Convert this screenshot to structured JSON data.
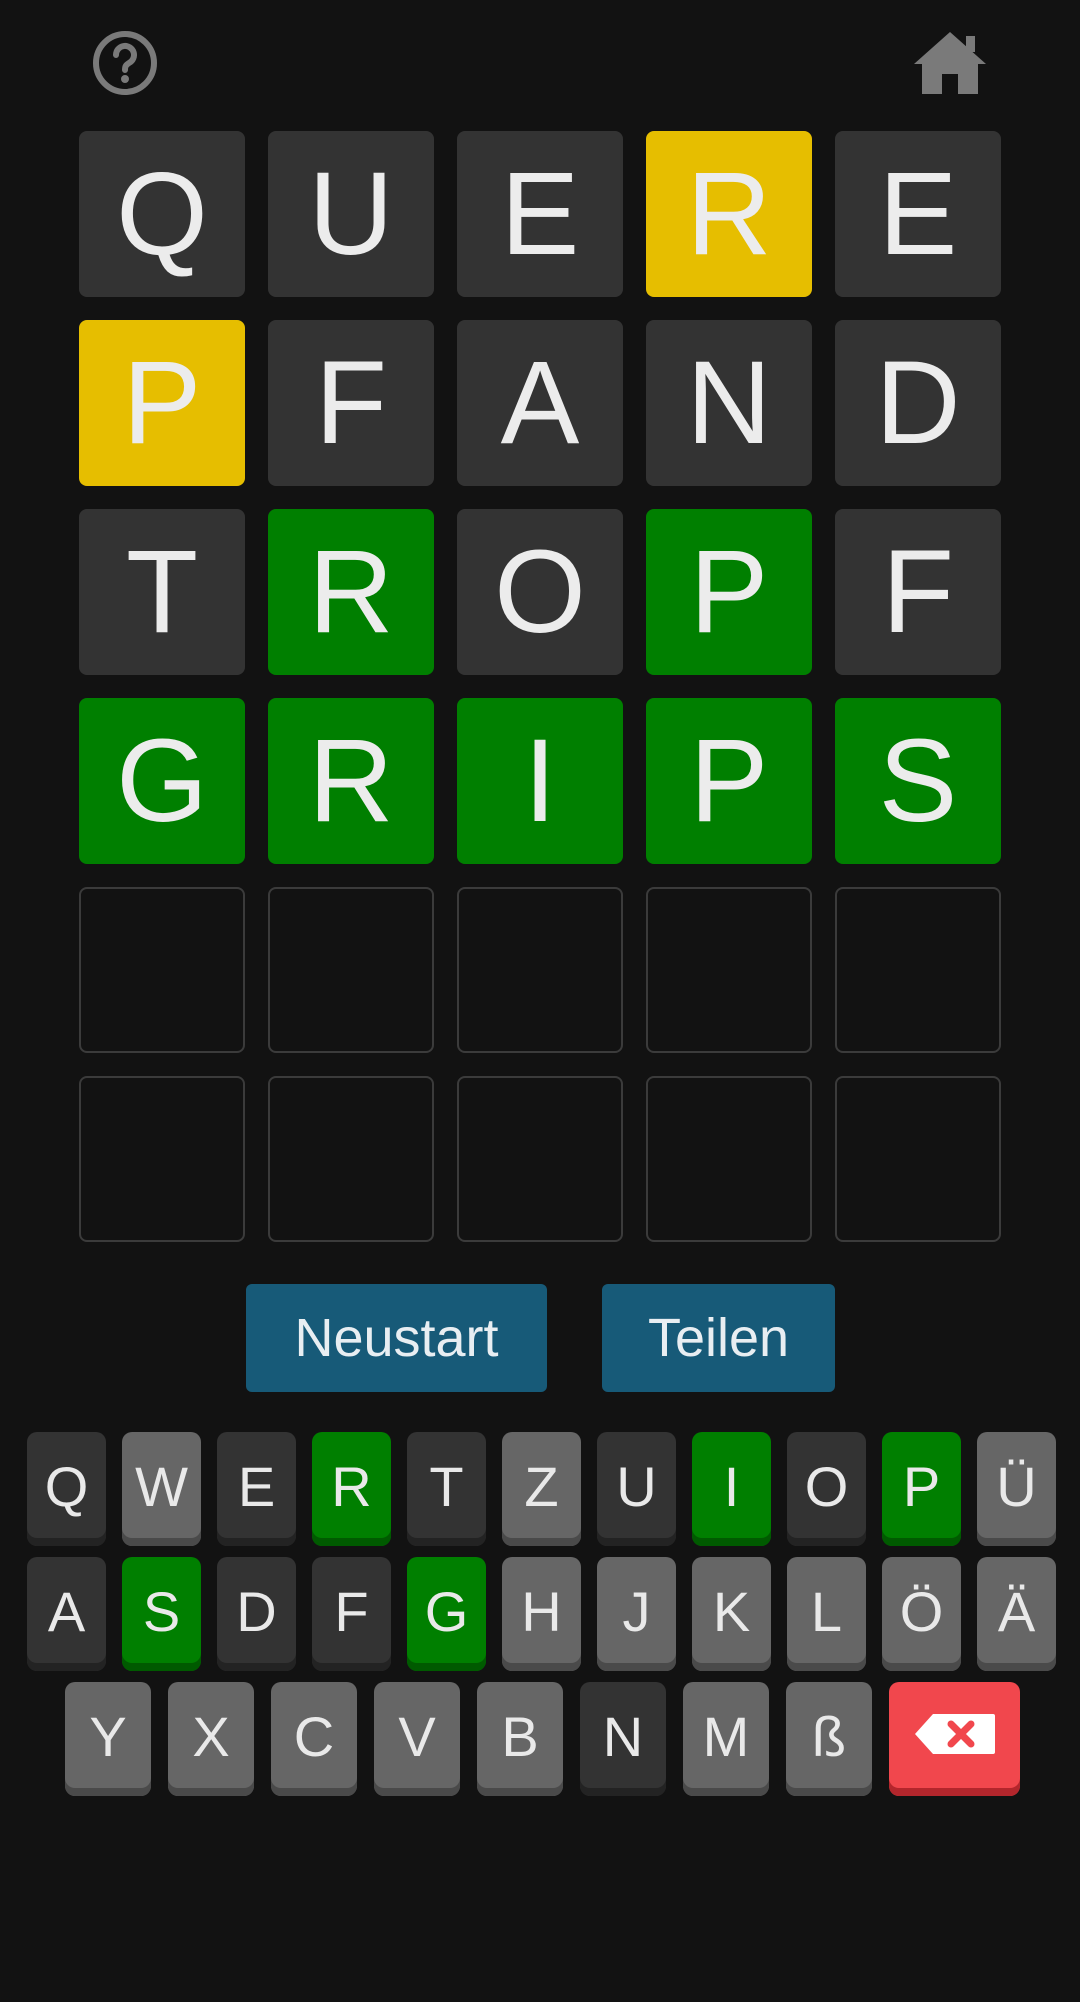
{
  "header": {
    "help_icon": "question-circle-icon",
    "home_icon": "home-icon"
  },
  "colors": {
    "background": "#121212",
    "absent": "#333333",
    "present": "#e6be00",
    "correct": "#007f00",
    "unused_key": "#666666",
    "button": "#175a78",
    "backspace": "#f1474d"
  },
  "board": {
    "rows": [
      [
        {
          "l": "Q",
          "s": "absent"
        },
        {
          "l": "U",
          "s": "absent"
        },
        {
          "l": "E",
          "s": "absent"
        },
        {
          "l": "R",
          "s": "present"
        },
        {
          "l": "E",
          "s": "absent"
        }
      ],
      [
        {
          "l": "P",
          "s": "present"
        },
        {
          "l": "F",
          "s": "absent"
        },
        {
          "l": "A",
          "s": "absent"
        },
        {
          "l": "N",
          "s": "absent"
        },
        {
          "l": "D",
          "s": "absent"
        }
      ],
      [
        {
          "l": "T",
          "s": "absent"
        },
        {
          "l": "R",
          "s": "correct"
        },
        {
          "l": "O",
          "s": "absent"
        },
        {
          "l": "P",
          "s": "correct"
        },
        {
          "l": "F",
          "s": "absent"
        }
      ],
      [
        {
          "l": "G",
          "s": "correct"
        },
        {
          "l": "R",
          "s": "correct"
        },
        {
          "l": "I",
          "s": "correct"
        },
        {
          "l": "P",
          "s": "correct"
        },
        {
          "l": "S",
          "s": "correct"
        }
      ],
      [
        {
          "l": "",
          "s": "empty"
        },
        {
          "l": "",
          "s": "empty"
        },
        {
          "l": "",
          "s": "empty"
        },
        {
          "l": "",
          "s": "empty"
        },
        {
          "l": "",
          "s": "empty"
        }
      ],
      [
        {
          "l": "",
          "s": "empty"
        },
        {
          "l": "",
          "s": "empty"
        },
        {
          "l": "",
          "s": "empty"
        },
        {
          "l": "",
          "s": "empty"
        },
        {
          "l": "",
          "s": "empty"
        }
      ]
    ]
  },
  "actions": {
    "restart_label": "Neustart",
    "share_label": "Teilen"
  },
  "keyboard": {
    "rows": [
      [
        {
          "k": "Q",
          "s": "absent"
        },
        {
          "k": "W",
          "s": "unused"
        },
        {
          "k": "E",
          "s": "absent"
        },
        {
          "k": "R",
          "s": "correct"
        },
        {
          "k": "T",
          "s": "absent"
        },
        {
          "k": "Z",
          "s": "unused"
        },
        {
          "k": "U",
          "s": "absent"
        },
        {
          "k": "I",
          "s": "correct"
        },
        {
          "k": "O",
          "s": "absent"
        },
        {
          "k": "P",
          "s": "correct"
        },
        {
          "k": "Ü",
          "s": "unused"
        }
      ],
      [
        {
          "k": "A",
          "s": "absent"
        },
        {
          "k": "S",
          "s": "correct"
        },
        {
          "k": "D",
          "s": "absent"
        },
        {
          "k": "F",
          "s": "absent"
        },
        {
          "k": "G",
          "s": "correct"
        },
        {
          "k": "H",
          "s": "unused"
        },
        {
          "k": "J",
          "s": "unused"
        },
        {
          "k": "K",
          "s": "unused"
        },
        {
          "k": "L",
          "s": "unused"
        },
        {
          "k": "Ö",
          "s": "unused"
        },
        {
          "k": "Ä",
          "s": "unused"
        }
      ],
      [
        {
          "k": "Y",
          "s": "unused"
        },
        {
          "k": "X",
          "s": "unused"
        },
        {
          "k": "C",
          "s": "unused"
        },
        {
          "k": "V",
          "s": "unused"
        },
        {
          "k": "B",
          "s": "unused"
        },
        {
          "k": "N",
          "s": "absent"
        },
        {
          "k": "M",
          "s": "unused"
        },
        {
          "k": "ß",
          "s": "unused"
        }
      ]
    ],
    "backspace_icon": "backspace-icon"
  }
}
